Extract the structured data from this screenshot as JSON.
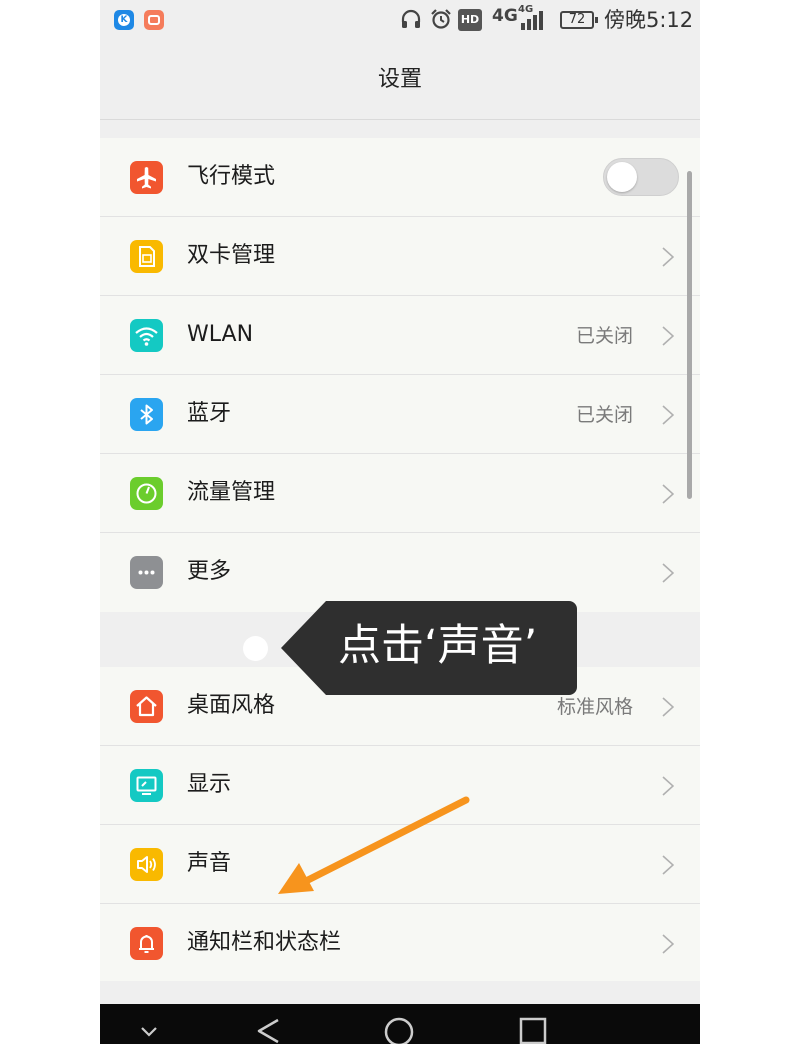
{
  "status_bar": {
    "apps": [
      {
        "icon": "k-app-icon",
        "letter": "K",
        "color": "#1e88e5"
      },
      {
        "icon": "message-app-icon",
        "color": "#f57c5b"
      }
    ],
    "icons": [
      "headphones-icon",
      "alarm-icon",
      "hd-badge",
      "4g-icon",
      "signal-icon"
    ],
    "hd": "HD",
    "network": "4G",
    "network2": "4G",
    "battery": "72",
    "time": "傍晚5:12"
  },
  "header": {
    "title": "设置"
  },
  "groups": [
    {
      "items": [
        {
          "label": "飞行模式",
          "icon": "airplane-icon",
          "color": "#f1562f",
          "control": "toggle",
          "toggle_on": false
        },
        {
          "label": "双卡管理",
          "icon": "sim-card-icon",
          "color": "#f9b900",
          "control": "chevron"
        },
        {
          "label": "WLAN",
          "value": "已关闭",
          "icon": "wifi-icon",
          "color": "#14c9c3",
          "control": "chevron"
        },
        {
          "label": "蓝牙",
          "value": "已关闭",
          "icon": "bluetooth-icon",
          "color": "#2aa5f0",
          "control": "chevron"
        },
        {
          "label": "流量管理",
          "icon": "data-usage-icon",
          "color": "#6bcd2c",
          "control": "chevron"
        },
        {
          "label": "更多",
          "icon": "more-icon",
          "color": "#8e9093",
          "control": "chevron"
        }
      ]
    },
    {
      "items": [
        {
          "label": "桌面风格",
          "value": "标准风格",
          "icon": "home-icon",
          "color": "#f1562f",
          "control": "chevron"
        },
        {
          "label": "显示",
          "icon": "display-icon",
          "color": "#14c9c3",
          "control": "chevron"
        },
        {
          "label": "声音",
          "icon": "sound-icon",
          "color": "#f9b900",
          "control": "chevron"
        },
        {
          "label": "通知栏和状态栏",
          "icon": "notification-icon",
          "color": "#f1562f",
          "control": "chevron"
        }
      ]
    }
  ],
  "annotation": {
    "text": "点击‘声音’",
    "arrow_color": "#f7941d"
  },
  "nav_bar": {
    "buttons": [
      "collapse-icon",
      "back-icon",
      "home-icon",
      "recents-icon"
    ]
  }
}
